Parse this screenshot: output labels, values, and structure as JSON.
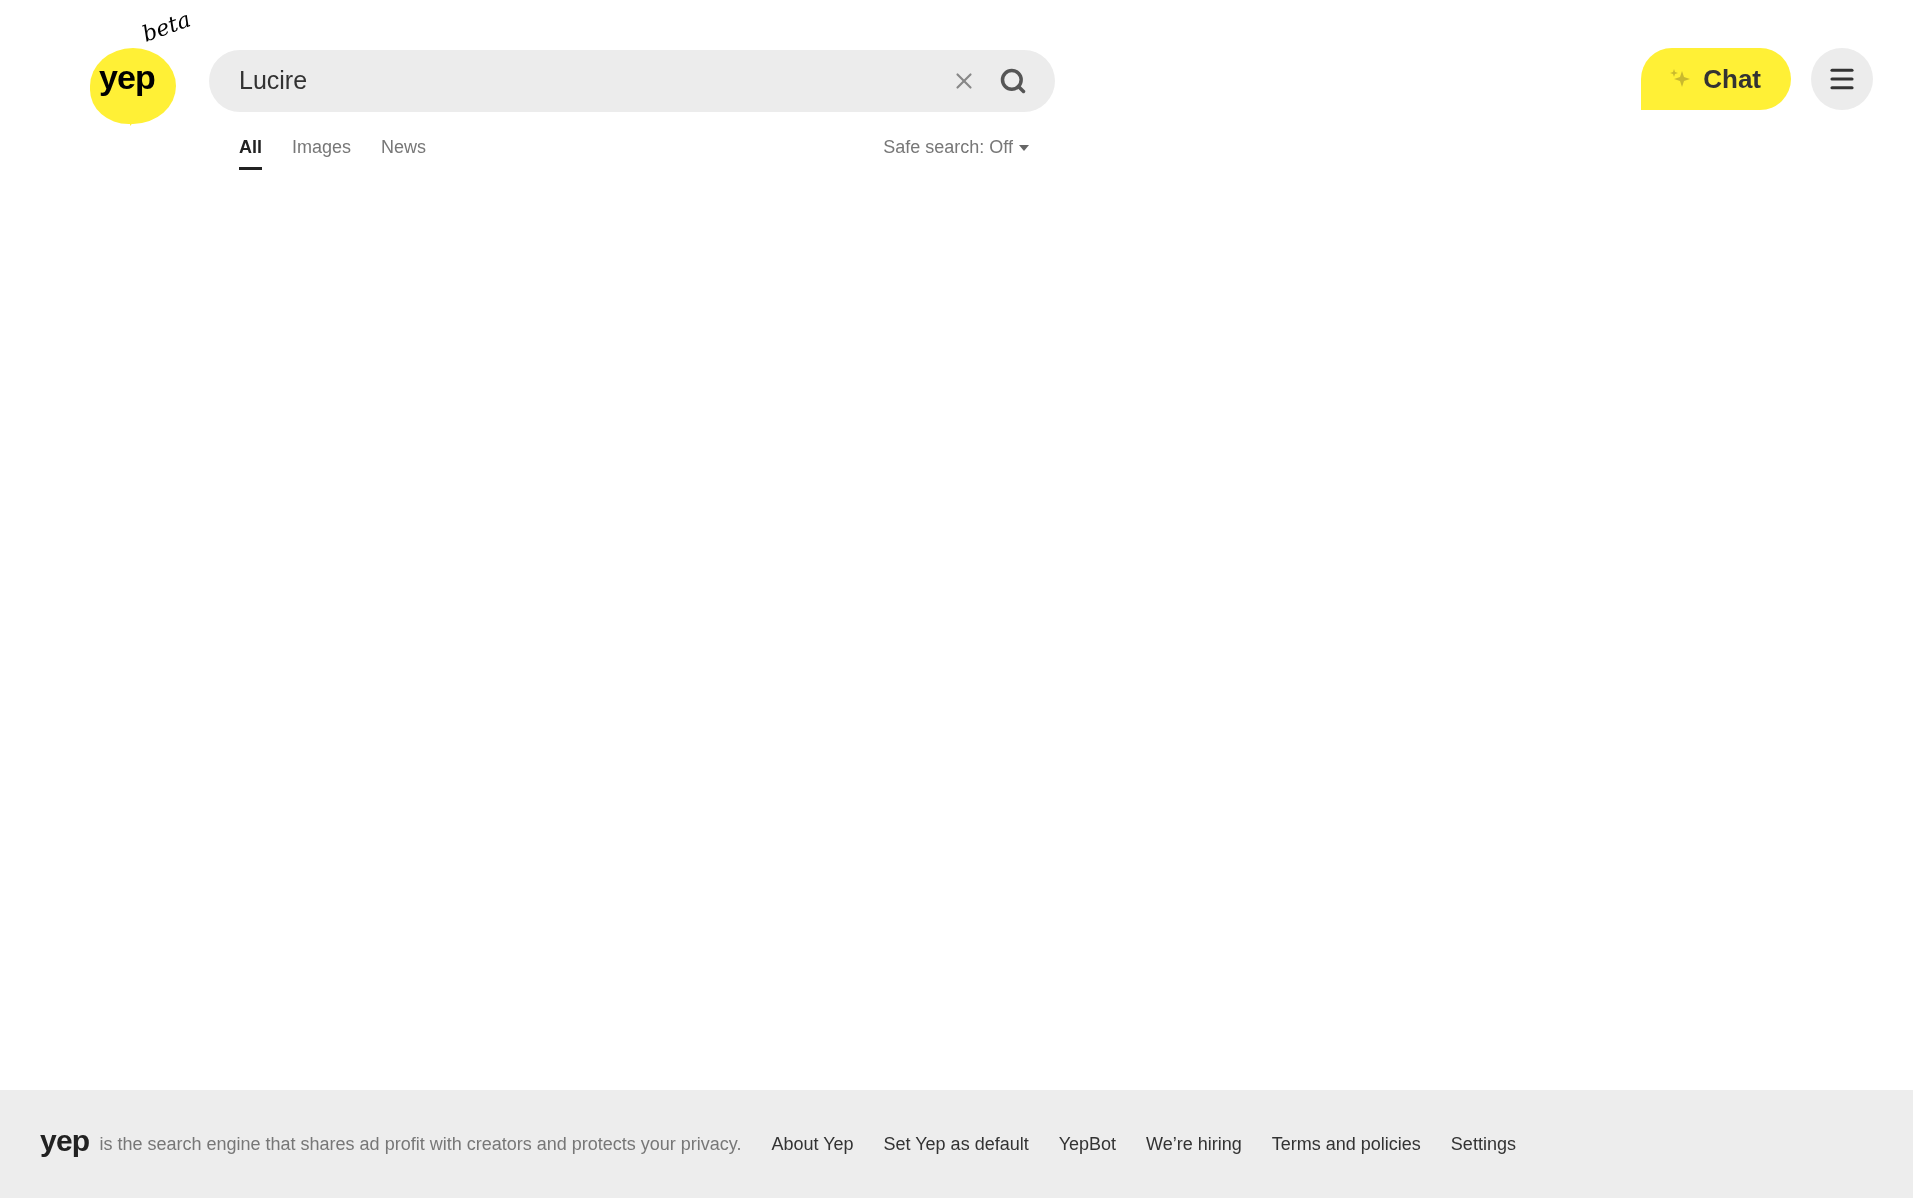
{
  "logo": {
    "wordmark": "yep",
    "badge": "beta"
  },
  "search": {
    "value": "Lucire"
  },
  "tabs": [
    {
      "label": "All",
      "selected": true
    },
    {
      "label": "Images",
      "selected": false
    },
    {
      "label": "News",
      "selected": false
    }
  ],
  "safe_search": {
    "label": "Safe search: Off"
  },
  "chat_button": {
    "label": "Chat"
  },
  "footer": {
    "wordmark": "yep",
    "tagline": "is the search engine that shares ad profit with creators and protects your privacy.",
    "links": [
      "About Yep",
      "Set Yep as default",
      "YepBot",
      "We’re hiring",
      "Terms and policies",
      "Settings"
    ]
  }
}
